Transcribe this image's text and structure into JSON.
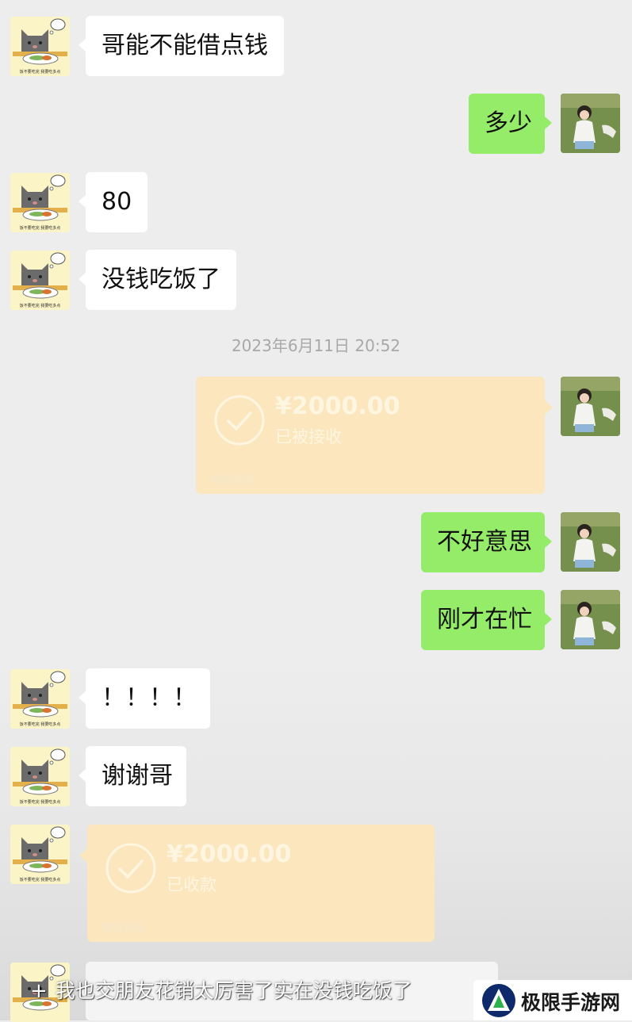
{
  "messages": {
    "m1": "哥能不能借点钱",
    "m2": "多少",
    "m3": "80",
    "m4": "没钱吃饭了",
    "timestamp": "2023年6月11日 20:52",
    "transfer1": {
      "amount": "¥2000.00",
      "status": "已被接收",
      "footer": "微信转账"
    },
    "m5": "不好意思",
    "m6": "刚才在忙",
    "m7": "！！！！",
    "m8": "谢谢哥",
    "transfer2": {
      "amount": "¥2000.00",
      "status": "已收款",
      "footer": "微信转账"
    }
  },
  "avatar_caption": "饭不要吃完 我要吃多点",
  "overlay": {
    "plus": "+",
    "caption": "我也交朋友花销太厉害了实在没钱吃饭了",
    "watermark_text": "极限手游网"
  },
  "icons": {
    "contact_avatar": "cat-eating-icon",
    "self_avatar": "girl-photo-icon",
    "transfer": "check-circle-icon",
    "watermark_logo": "triangle-logo-icon"
  },
  "colors": {
    "background": "#ededed",
    "incoming_bubble": "#ffffff",
    "outgoing_bubble": "#95ec69",
    "transfer_card": "#fbe6bd"
  }
}
